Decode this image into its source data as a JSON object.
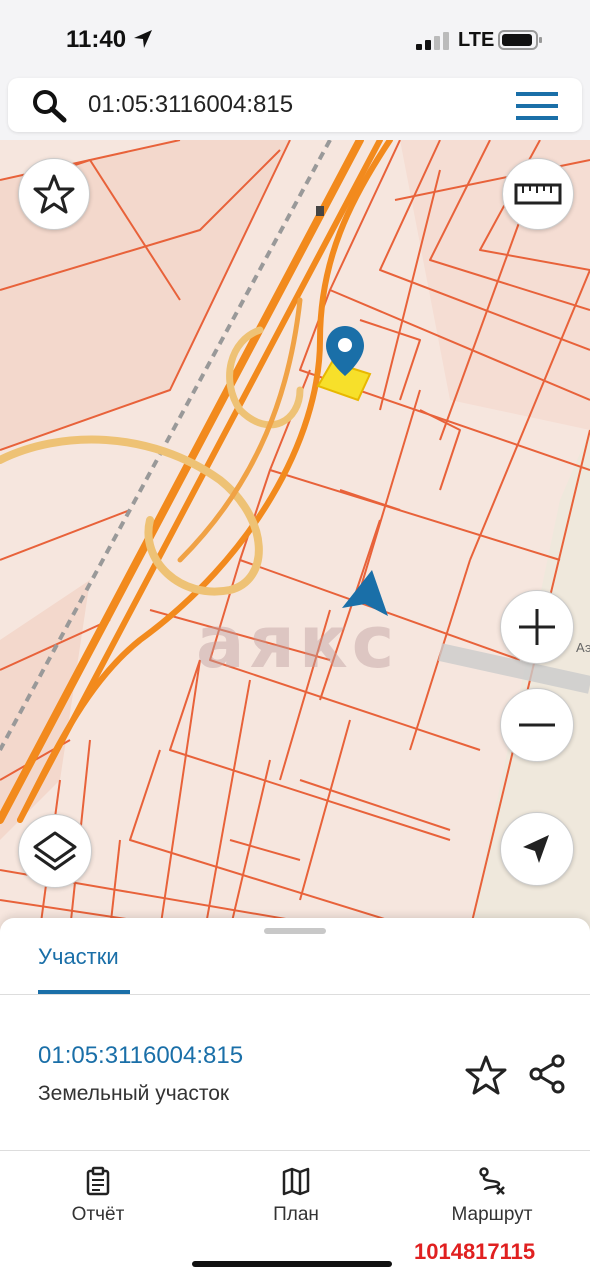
{
  "status_bar": {
    "time": "11:40",
    "network": "LTE"
  },
  "search": {
    "query": "01:05:3116004:815"
  },
  "map": {
    "watermark": "аякс",
    "street_label": "Аэ"
  },
  "sheet": {
    "tab": "Участки",
    "parcel": {
      "number": "01:05:3116004:815",
      "type": "Земельный участок"
    }
  },
  "bottom_nav": [
    {
      "label": "Отчёт",
      "icon": "clipboard-icon"
    },
    {
      "label": "План",
      "icon": "map-icon"
    },
    {
      "label": "Маршрут",
      "icon": "route-icon"
    }
  ],
  "listing_id": "1014817115",
  "colors": {
    "accent": "#1a6fa8",
    "parcel_border": "#e8623a",
    "highway": "#f28a1d",
    "selected": "#f7e02a",
    "listing_id": "#e02020"
  }
}
